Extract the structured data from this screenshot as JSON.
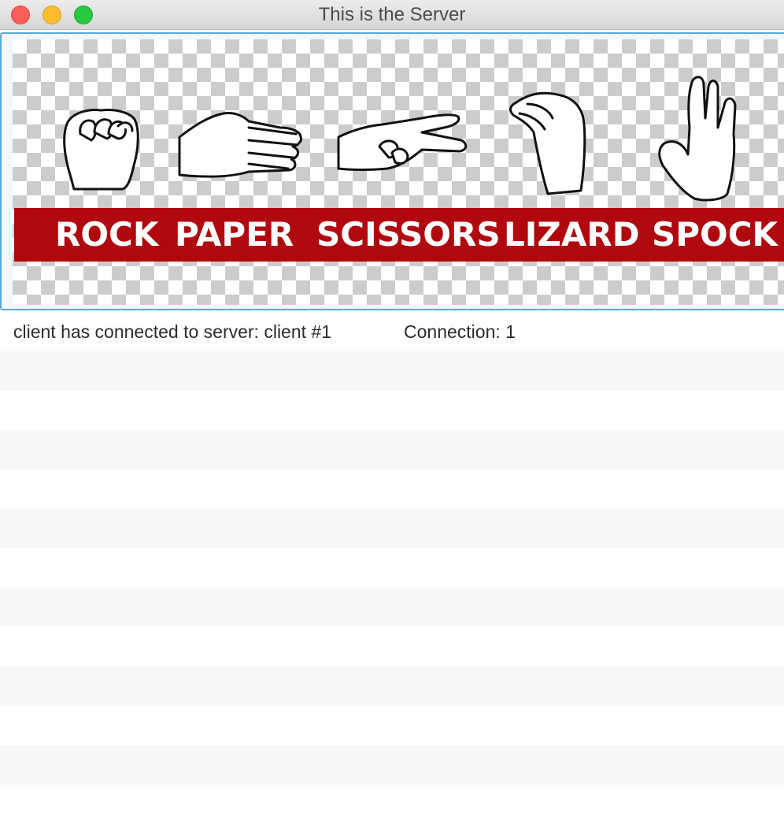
{
  "window": {
    "title": "This is the Server",
    "traffic_lights": [
      "close-button",
      "minimize-button",
      "maximize-button"
    ]
  },
  "banner": {
    "words": [
      "ROCK",
      "PAPER",
      "SCISSORS",
      "LIZARD",
      "SPOCK"
    ],
    "background_color": "#b0080e",
    "text_color": "#ffffff"
  },
  "status": {
    "message": "client has connected to server: client #1",
    "connection": "Connection: 1"
  },
  "colors": {
    "row_alt": "#f8f8f8",
    "row_plain": "#ffffff",
    "frame_border": "#5aa8d8"
  }
}
